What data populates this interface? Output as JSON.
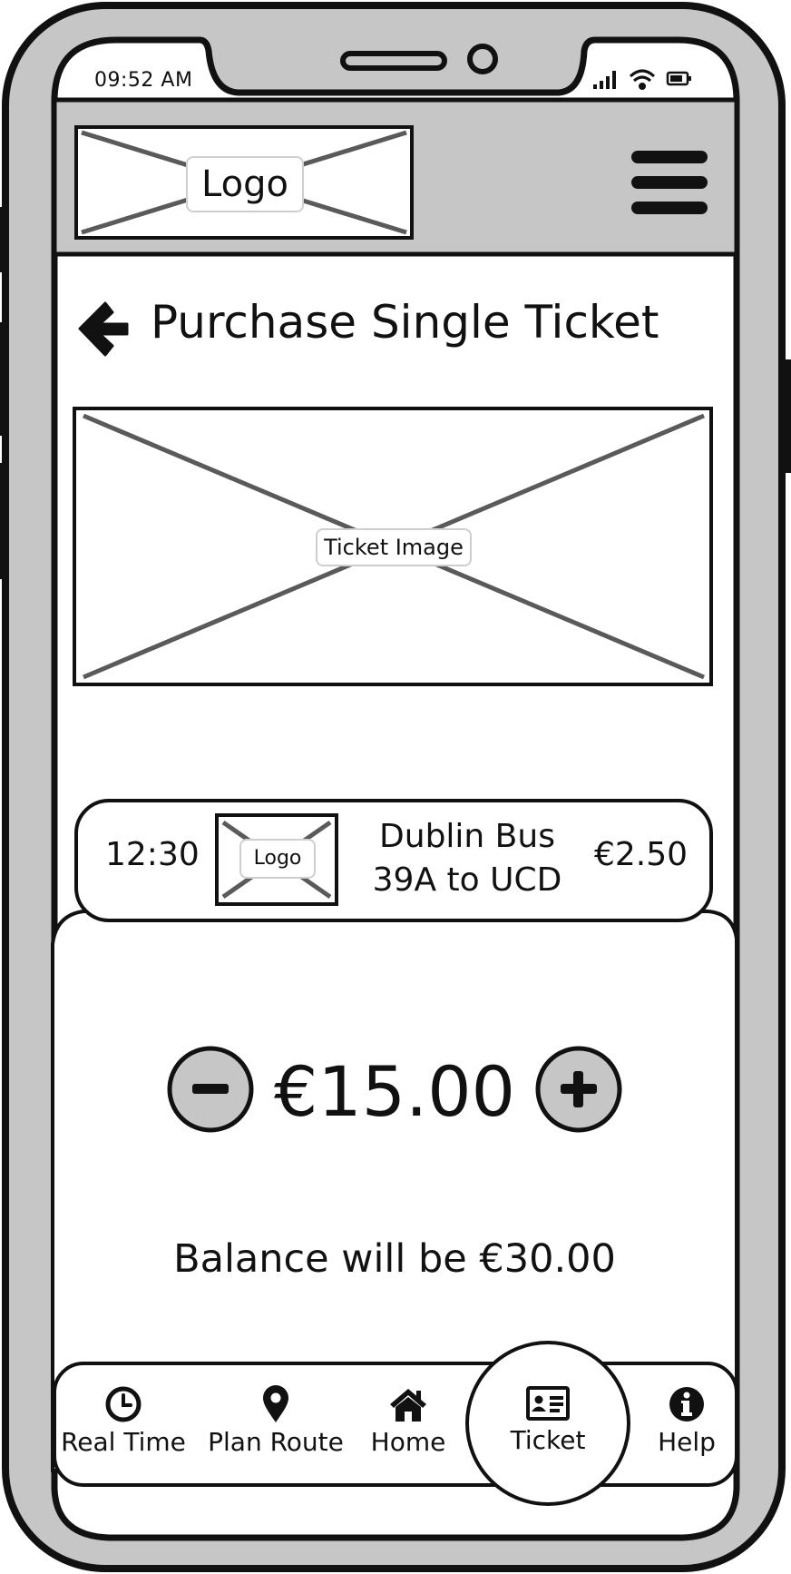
{
  "status_bar": {
    "time": "09:52 AM",
    "icons": [
      "signal-icon",
      "wifi-icon",
      "battery-icon"
    ]
  },
  "header": {
    "logo_text": "Logo",
    "menu_icon": "hamburger-menu-icon"
  },
  "page": {
    "back_icon": "back-arrow-icon",
    "title": "Purchase Single Ticket",
    "ticket_image_label": "Ticket Image"
  },
  "ticket_row": {
    "time": "12:30",
    "logo_text": "Logo",
    "route_line1": "Dublin Bus",
    "route_line2": "39A to UCD",
    "price": "€2.50"
  },
  "purchase": {
    "amount": "€15.00",
    "decrease_icon": "minus-icon",
    "increase_icon": "plus-icon",
    "balance_text": "Balance will be €30.00"
  },
  "nav": {
    "items": [
      {
        "label": "Real Time",
        "icon": "clock-icon"
      },
      {
        "label": "Plan Route",
        "icon": "map-pin-icon"
      },
      {
        "label": "Home",
        "icon": "home-icon"
      },
      {
        "label": "Ticket",
        "icon": "id-card-icon",
        "active": true
      },
      {
        "label": "Help",
        "icon": "info-icon"
      }
    ]
  },
  "colors": {
    "frame_gray": "#c6c6c6",
    "outline": "#111111",
    "placeholder_cross": "#5a5a5a"
  }
}
